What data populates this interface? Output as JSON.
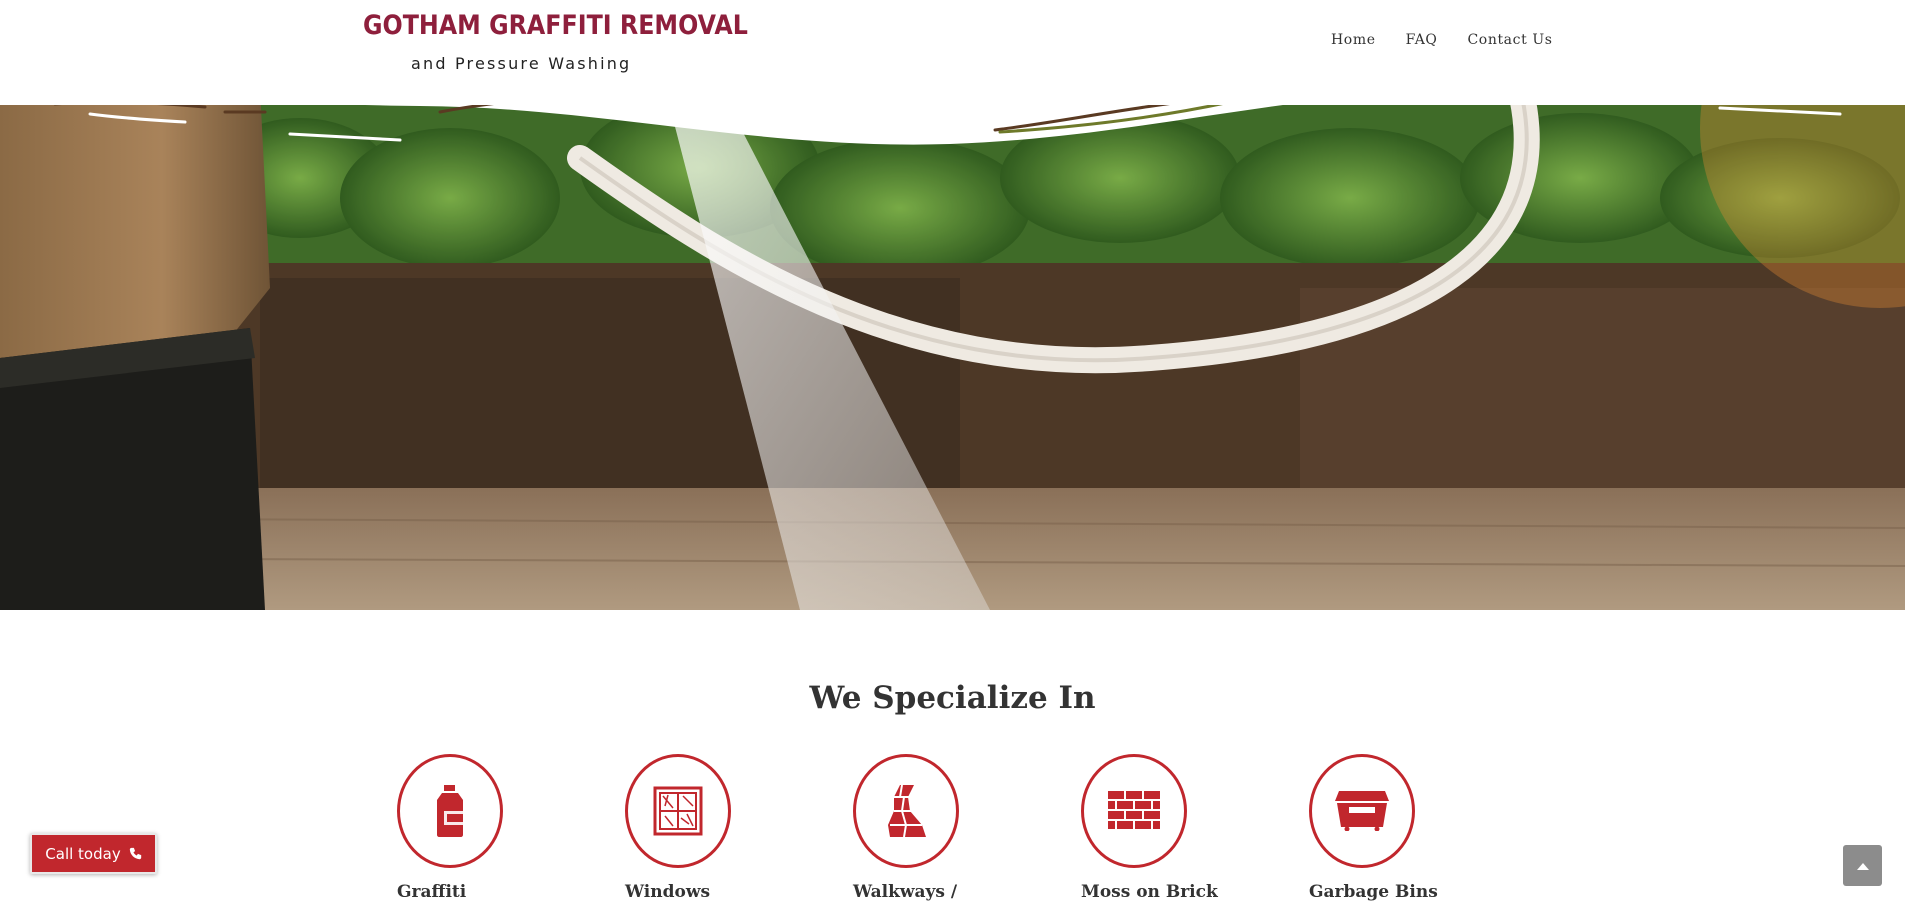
{
  "brand": {
    "title": "GOTHAM GRAFFITI REMOVAL",
    "subtitle": "and Pressure Washing",
    "color": "#8e1f3c"
  },
  "nav": {
    "items": [
      "Home",
      "FAQ",
      "Contact Us"
    ]
  },
  "specialize": {
    "heading": "We Specialize In",
    "accent_color": "#c1272d",
    "services": [
      {
        "label": "Graffiti",
        "icon": "spray-can-icon"
      },
      {
        "label": "Windows",
        "icon": "window-icon"
      },
      {
        "label": "Walkways /",
        "icon": "walkway-icon"
      },
      {
        "label": "Moss on Brick",
        "icon": "brick-wall-icon"
      },
      {
        "label": "Garbage Bins",
        "icon": "dumpster-icon"
      }
    ]
  },
  "call_button": {
    "label": "Call today",
    "icon": "phone-icon"
  },
  "scroll_top": {
    "icon": "chevron-up-icon"
  }
}
